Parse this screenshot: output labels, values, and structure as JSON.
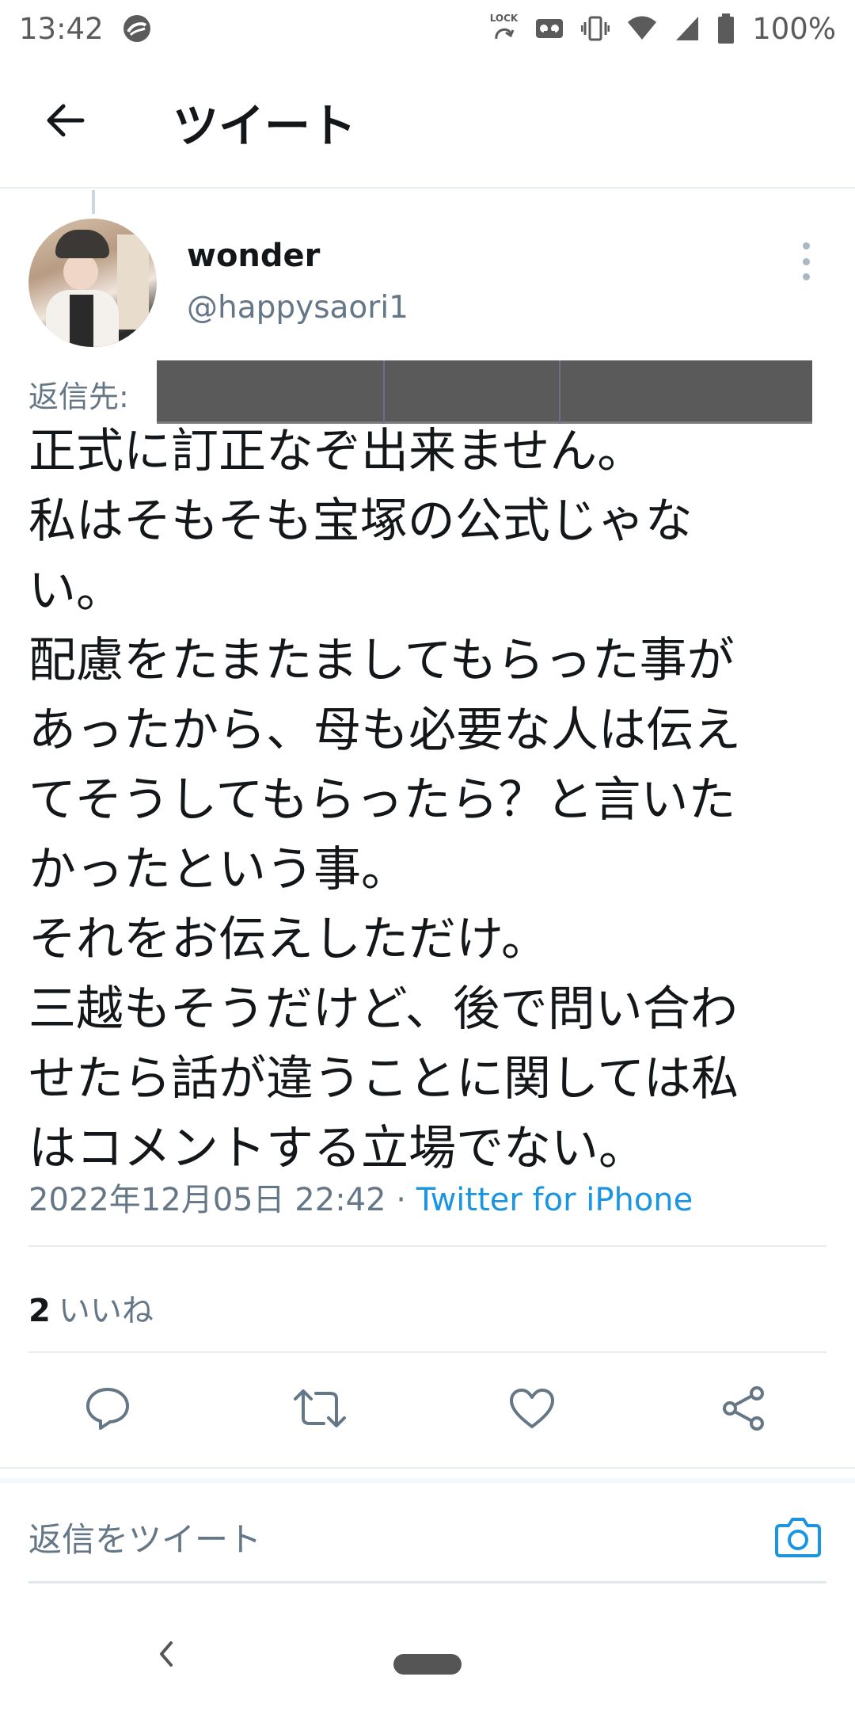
{
  "status_bar": {
    "time": "13:42",
    "lock_label": "LOCK",
    "battery": "100%",
    "icons": [
      "sync-icon",
      "lock-rotation-icon",
      "voicemail-icon",
      "vibrate-icon",
      "wifi-icon",
      "signal-icon",
      "battery-icon"
    ]
  },
  "header": {
    "title": "ツイート",
    "back_icon": "arrow-left-icon"
  },
  "tweet": {
    "display_name": "wonder",
    "username": "@happysaori1",
    "reply_to_label": "返信先: ",
    "body_lines": [
      "正式に訂正なぞ出来ません。",
      "私はそもそも宝塚の公式じゃな",
      "い。",
      "配慮をたまたましてもらった事が",
      "あったから、母も必要な人は伝え",
      "てそうしてもらったら？と言いた",
      "かったという事。",
      "それをお伝えしただけ。",
      "三越もそうだけど、後で問い合わ",
      "せたら話が違うことに関しては私",
      "はコメントする立場でない。"
    ],
    "datetime": "2022年12月05日 22:42",
    "separator": " · ",
    "source": "Twitter for iPhone",
    "likes_count": "2",
    "likes_label": "いいね"
  },
  "actions": [
    {
      "name": "reply",
      "icon": "comment-icon"
    },
    {
      "name": "retweet",
      "icon": "retweet-icon"
    },
    {
      "name": "like",
      "icon": "heart-icon"
    },
    {
      "name": "share",
      "icon": "share-icon"
    }
  ],
  "reply_bar": {
    "placeholder": "返信をツイート",
    "camera_icon": "camera-icon"
  },
  "colors": {
    "accent": "#1b95e0",
    "muted": "#657786",
    "text": "#14171a",
    "divider": "#e6ecf0"
  }
}
